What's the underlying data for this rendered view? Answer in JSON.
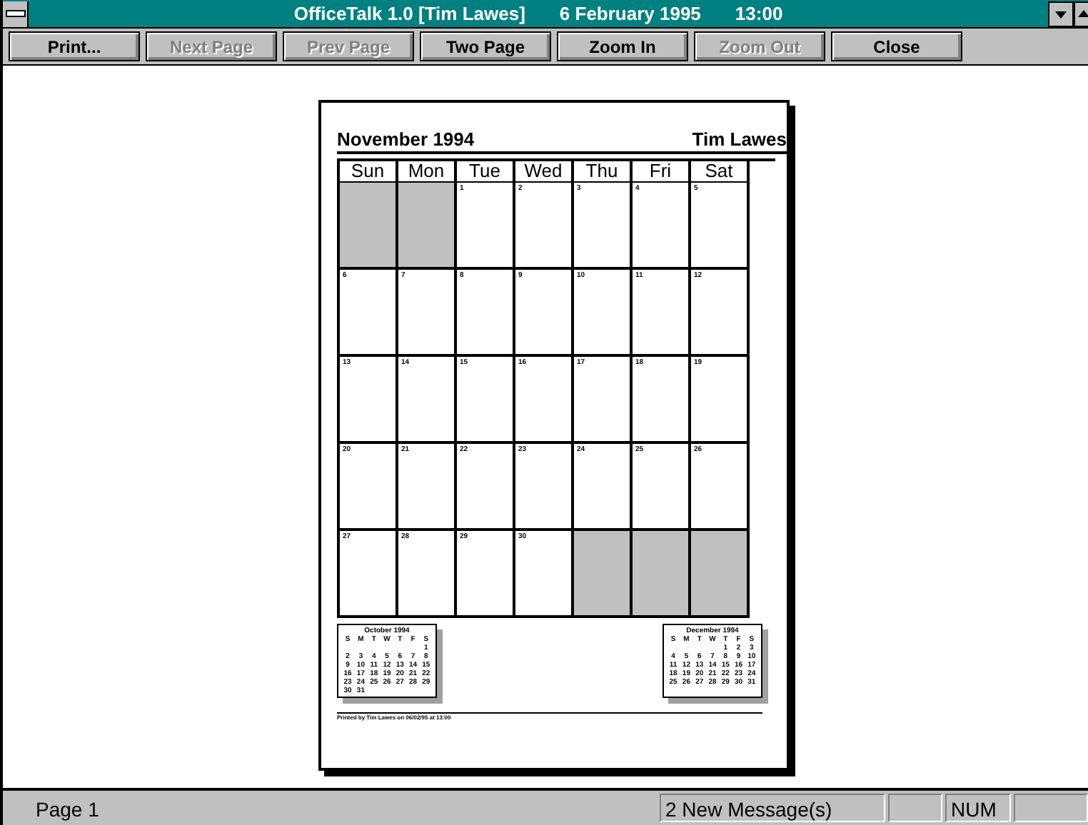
{
  "window": {
    "title": "OfficeTalk 1.0 [Tim Lawes]",
    "date": "6 February 1995",
    "time": "13:00"
  },
  "toolbar": [
    {
      "label": "Print...",
      "disabled": false
    },
    {
      "label": "Next Page",
      "disabled": true
    },
    {
      "label": "Prev Page",
      "disabled": true
    },
    {
      "label": "Two Page",
      "disabled": false
    },
    {
      "label": "Zoom In",
      "disabled": false
    },
    {
      "label": "Zoom Out",
      "disabled": true
    },
    {
      "label": "Close",
      "disabled": false
    }
  ],
  "page": {
    "month": "November 1994",
    "owner": "Tim Lawes",
    "weekdays": [
      "Sun",
      "Mon",
      "Tue",
      "Wed",
      "Thu",
      "Fri",
      "Sat"
    ],
    "weeks": [
      [
        {
          "kind": "blank"
        },
        {
          "kind": "blank"
        },
        {
          "kind": "day",
          "day": "1"
        },
        {
          "kind": "day",
          "day": "2"
        },
        {
          "kind": "day",
          "day": "3"
        },
        {
          "kind": "day",
          "day": "4"
        },
        {
          "kind": "day",
          "day": "5"
        }
      ],
      [
        {
          "kind": "day",
          "day": "6"
        },
        {
          "kind": "day",
          "day": "7"
        },
        {
          "kind": "day",
          "day": "8"
        },
        {
          "kind": "day",
          "day": "9"
        },
        {
          "kind": "day",
          "day": "10"
        },
        {
          "kind": "day",
          "day": "11"
        },
        {
          "kind": "day",
          "day": "12"
        }
      ],
      [
        {
          "kind": "day",
          "day": "13"
        },
        {
          "kind": "day",
          "day": "14"
        },
        {
          "kind": "day",
          "day": "15"
        },
        {
          "kind": "day",
          "day": "16"
        },
        {
          "kind": "day",
          "day": "17"
        },
        {
          "kind": "day",
          "day": "18"
        },
        {
          "kind": "day",
          "day": "19"
        }
      ],
      [
        {
          "kind": "day",
          "day": "20"
        },
        {
          "kind": "day",
          "day": "21"
        },
        {
          "kind": "day",
          "day": "22"
        },
        {
          "kind": "day",
          "day": "23"
        },
        {
          "kind": "day",
          "day": "24"
        },
        {
          "kind": "day",
          "day": "25"
        },
        {
          "kind": "day",
          "day": "26"
        }
      ],
      [
        {
          "kind": "day",
          "day": "27"
        },
        {
          "kind": "day",
          "day": "28"
        },
        {
          "kind": "day",
          "day": "29"
        },
        {
          "kind": "day",
          "day": "30"
        },
        {
          "kind": "blank"
        },
        {
          "kind": "blank"
        },
        {
          "kind": "blank"
        }
      ]
    ],
    "mini_calendars": [
      {
        "title": "October 1994",
        "weekdays": [
          "S",
          "M",
          "T",
          "W",
          "T",
          "F",
          "S"
        ],
        "weeks": [
          {
            "kind": "lead",
            "days": [
              "1"
            ]
          },
          {
            "kind": "full",
            "days": [
              "2",
              "3",
              "4",
              "5",
              "6",
              "7",
              "8"
            ]
          },
          {
            "kind": "full",
            "days": [
              "9",
              "10",
              "11",
              "12",
              "13",
              "14",
              "15"
            ]
          },
          {
            "kind": "full",
            "days": [
              "16",
              "17",
              "18",
              "19",
              "20",
              "21",
              "22"
            ]
          },
          {
            "kind": "full",
            "days": [
              "23",
              "24",
              "25",
              "26",
              "27",
              "28",
              "29"
            ]
          },
          {
            "kind": "tail",
            "days": [
              "30",
              "31"
            ]
          }
        ]
      },
      {
        "title": "December 1994",
        "weekdays": [
          "S",
          "M",
          "T",
          "W",
          "T",
          "F",
          "S"
        ],
        "weeks": [
          {
            "kind": "lead",
            "days": [
              "1",
              "2",
              "3"
            ]
          },
          {
            "kind": "full",
            "days": [
              "4",
              "5",
              "6",
              "7",
              "8",
              "9",
              "10"
            ]
          },
          {
            "kind": "full",
            "days": [
              "11",
              "12",
              "13",
              "14",
              "15",
              "16",
              "17"
            ]
          },
          {
            "kind": "full",
            "days": [
              "18",
              "19",
              "20",
              "21",
              "22",
              "23",
              "24"
            ]
          },
          {
            "kind": "full",
            "days": [
              "25",
              "26",
              "27",
              "28",
              "29",
              "30",
              "31"
            ]
          }
        ]
      }
    ],
    "footer": "Printed by Tim Lawes on 06/02/95 at 13:00"
  },
  "status_bar": {
    "page": "Page 1",
    "messages": "2 New Message(s)",
    "num": "NUM"
  }
}
